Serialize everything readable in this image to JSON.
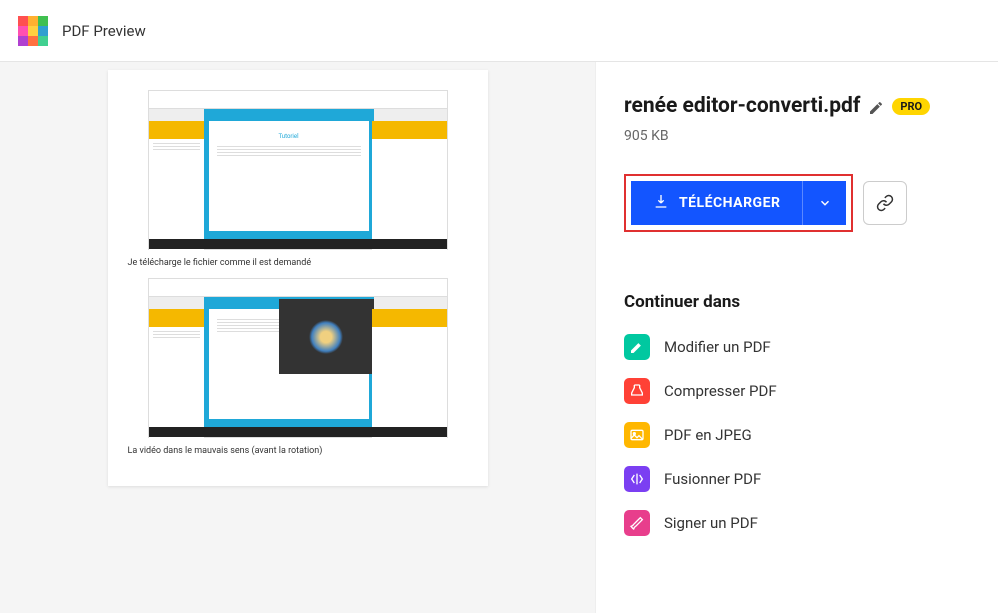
{
  "header": {
    "title": "PDF Preview"
  },
  "file": {
    "name": "renée editor-converti.pdf",
    "size": "905 KB",
    "pro_label": "PRO"
  },
  "preview": {
    "caption1": "Je télécharge le fichier comme il est demandé",
    "caption2": "La vidéo dans le mauvais sens (avant la rotation)",
    "tutorial": "Tutoriel"
  },
  "download": {
    "label": "TÉLÉCHARGER"
  },
  "continue": {
    "title": "Continuer dans",
    "tools": [
      {
        "label": "Modifier un PDF",
        "color": "#00c8a0"
      },
      {
        "label": "Compresser PDF",
        "color": "#ff4136"
      },
      {
        "label": "PDF en JPEG",
        "color": "#ffb700"
      },
      {
        "label": "Fusionner PDF",
        "color": "#7b3ff2"
      },
      {
        "label": "Signer un PDF",
        "color": "#e83e8c"
      }
    ]
  }
}
